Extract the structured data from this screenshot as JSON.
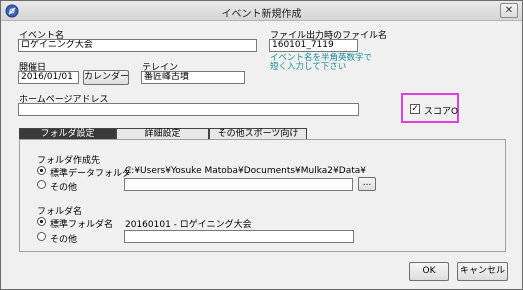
{
  "window": {
    "title": "イベント新規作成",
    "close_label": "✕"
  },
  "event_name": {
    "label": "イベント名",
    "value": "ロゲイニング大会"
  },
  "output_filename": {
    "label": "ファイル出力時のファイル名",
    "value": "160101_7119",
    "hint_line1": "イベント名を半角英数字で",
    "hint_line2": "短く入力して下さい"
  },
  "date": {
    "label": "開催日",
    "value": "2016/01/01",
    "calendar_button": "カレンダー"
  },
  "terrain": {
    "label": "テレイン",
    "value": "番匠峰古墳"
  },
  "homepage": {
    "label": "ホームページアドレス",
    "value": ""
  },
  "score_o": {
    "label": "スコアO",
    "checked": true,
    "check_glyph": "✓"
  },
  "tabs": [
    {
      "label": "フォルダ設定",
      "active": true
    },
    {
      "label": "詳細設定",
      "active": false
    },
    {
      "label": "その他スポーツ向け",
      "active": false
    }
  ],
  "folder_creation": {
    "group_label": "フォルダ作成先",
    "option_standard": "標準データフォルダ",
    "standard_path": "C:¥Users¥Yosuke Matoba¥Documents¥Mulka2¥Data¥",
    "option_other": "その他",
    "other_value": "",
    "browse_label": "..."
  },
  "folder_name": {
    "group_label": "フォルダ名",
    "option_standard": "標準フォルダ名",
    "standard_value": "20160101 - ロゲイニング大会",
    "option_other": "その他",
    "other_value": ""
  },
  "actions": {
    "ok": "OK",
    "cancel": "キャンセル"
  }
}
